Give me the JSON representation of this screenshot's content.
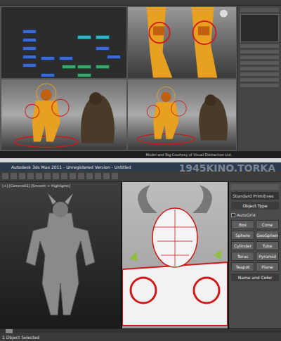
{
  "top_window": {
    "schematic": {
      "nodes": [
        {
          "color": "#3b6ad6"
        },
        {
          "color": "#3b6ad6"
        },
        {
          "color": "#3b6ad6"
        },
        {
          "color": "#3b6ad6"
        },
        {
          "color": "#3b6ad6"
        },
        {
          "color": "#3b6ad6"
        },
        {
          "color": "#3b6ad6"
        },
        {
          "color": "#2fb5c8"
        },
        {
          "color": "#2fb5c8"
        },
        {
          "color": "#3aa86a"
        },
        {
          "color": "#3aa86a"
        },
        {
          "color": "#3aa86a"
        },
        {
          "color": "#3b6ad6"
        },
        {
          "color": "#3aa86a"
        },
        {
          "color": "#3b6ad6"
        },
        {
          "color": "#3b6ad6"
        }
      ]
    },
    "caption": "Model and Rig Courtesy of Visual Distraction Ltd."
  },
  "bottom_window": {
    "title": "Autodesk 3ds Max 2011 - Unregistered Version - Untitled",
    "watermark": "1945KINO.TORKA",
    "viewport_label": "[+] [Camera01] [Smooth + Highlights]",
    "command_panel": {
      "dropdown": "Standard Primitives",
      "section": "Object Type",
      "autogrid": {
        "label": "AutoGrid",
        "checked": false
      },
      "buttons": [
        "Box",
        "Cone",
        "Sphere",
        "GeoSphere",
        "Cylinder",
        "Tube",
        "Torus",
        "Pyramid",
        "Teapot",
        "Plane"
      ],
      "section2": "Name and Color"
    },
    "time_slider": {
      "level": 0.02
    },
    "status": "1 Object Selected"
  }
}
